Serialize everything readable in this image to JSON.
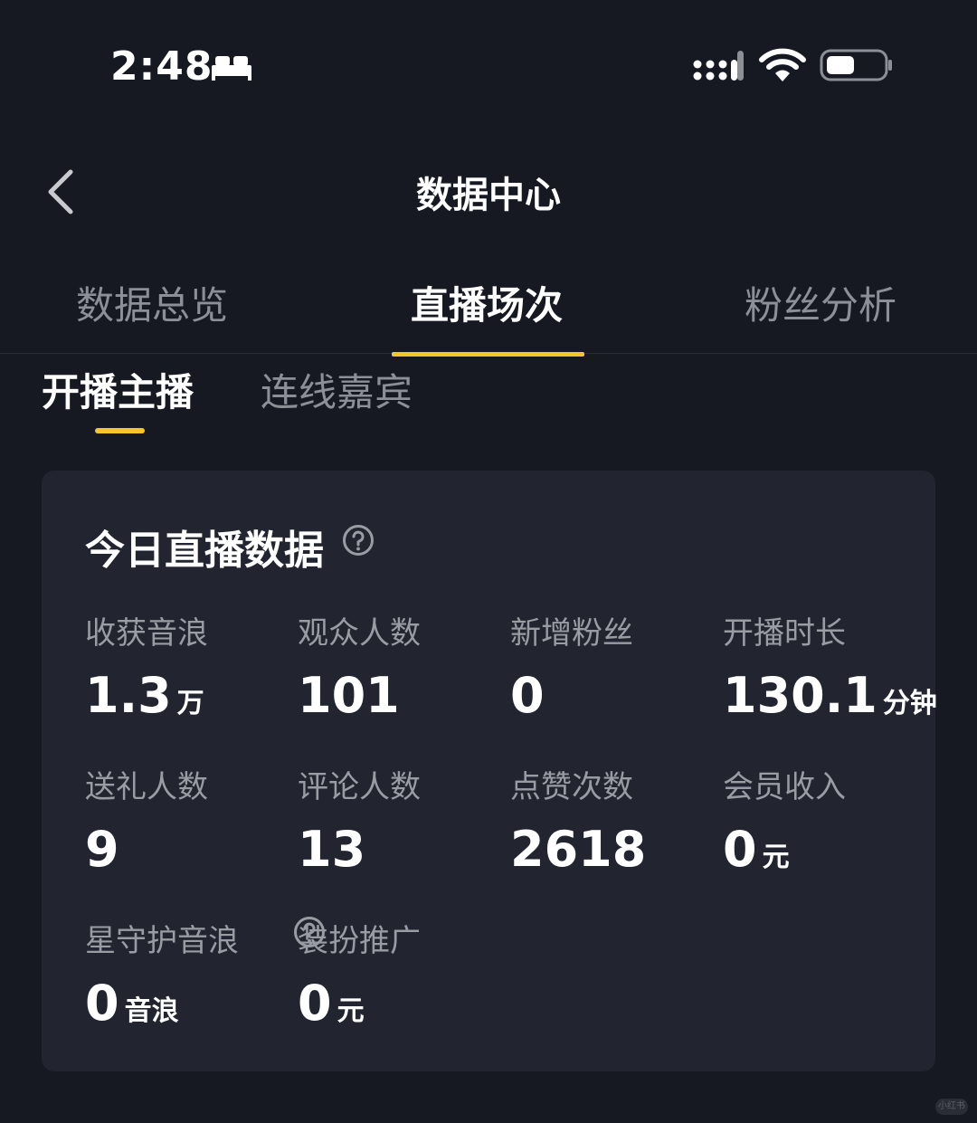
{
  "status_bar": {
    "time": "2:48",
    "icons": [
      "bed-icon",
      "signal-icon",
      "wifi-icon",
      "battery-icon"
    ]
  },
  "header": {
    "title": "数据中心",
    "back_icon": "chevron-left-icon"
  },
  "top_tabs": [
    {
      "label": "数据总览",
      "active": false
    },
    {
      "label": "直播场次",
      "active": true
    },
    {
      "label": "粉丝分析",
      "active": false
    }
  ],
  "sub_tabs": [
    {
      "label": "开播主播",
      "active": true
    },
    {
      "label": "连线嘉宾",
      "active": false
    }
  ],
  "card": {
    "title": "今日直播数据",
    "metrics": [
      {
        "label": "收获音浪",
        "value": "1.3",
        "unit": "万"
      },
      {
        "label": "观众人数",
        "value": "101",
        "unit": ""
      },
      {
        "label": "新增粉丝",
        "value": "0",
        "unit": ""
      },
      {
        "label": "开播时长",
        "value": "130.1",
        "unit": "分钟"
      },
      {
        "label": "送礼人数",
        "value": "9",
        "unit": ""
      },
      {
        "label": "评论人数",
        "value": "13",
        "unit": ""
      },
      {
        "label": "点赞次数",
        "value": "2618",
        "unit": ""
      },
      {
        "label": "会员收入",
        "value": "0",
        "unit": "元"
      },
      {
        "label": "星守护音浪",
        "value": "0",
        "unit": "音浪"
      },
      {
        "label": "装扮推广",
        "value": "0",
        "unit": "元"
      }
    ]
  },
  "watermark": "小红书",
  "colors": {
    "background": "#161822",
    "card": "#222530",
    "accent": "#f7c52b",
    "muted_text": "#9a9ca4"
  }
}
